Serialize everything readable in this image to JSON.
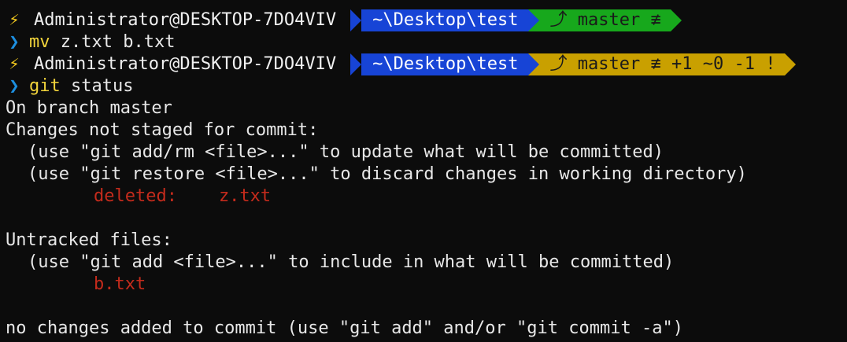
{
  "prompt": {
    "bolt_icon": "⚡",
    "user_host": "Administrator@DESKTOP-7DO4VIV",
    "path": "~\\Desktop\\test",
    "chevron_icon": "❯"
  },
  "prompt1": {
    "branch": "⤴ master ≢"
  },
  "command1": {
    "name": "mv",
    "args": " z.txt b.txt"
  },
  "prompt2": {
    "branch": "⤴ master ≢ +1 ~0 -1 !"
  },
  "command2": {
    "name": "git",
    "args": " status"
  },
  "output": {
    "line1": "On branch master",
    "line2": "Changes not staged for commit:",
    "line3": "(use \"git add/rm <file>...\" to update what will be committed)",
    "line4": "(use \"git restore <file>...\" to discard changes in working directory)",
    "deleted_label": "deleted:    z.txt",
    "line_blank": "",
    "untracked_header": "Untracked files:",
    "untracked_hint": "(use \"git add <file>...\" to include in what will be committed)",
    "untracked_file": "b.txt",
    "final": "no changes added to commit (use \"git add\" and/or \"git commit -a\")"
  },
  "colors": {
    "background": "#0c0c0c",
    "path_segment": "#1744d6",
    "branch_clean": "#17a81c",
    "branch_dirty": "#c9a000",
    "error_red": "#c42b1c",
    "command_yellow": "#f2d43b"
  }
}
